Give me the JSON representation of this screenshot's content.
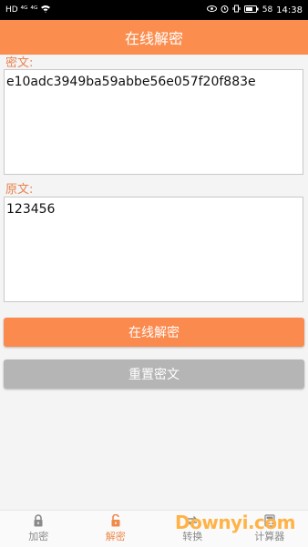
{
  "status_bar": {
    "left": "HD ⁴ᴳ ⁴ᴳ",
    "battery": "58",
    "time": "14:38"
  },
  "app": {
    "title": "在线解密"
  },
  "cipher": {
    "label": "密文:",
    "value": "e10adc3949ba59abbe56e057f20f883e"
  },
  "plain": {
    "label": "原文:",
    "value": "123456"
  },
  "buttons": {
    "decrypt": "在线解密",
    "reset": "重置密文"
  },
  "nav": {
    "items": [
      {
        "label": "加密",
        "icon": "lock-icon"
      },
      {
        "label": "解密",
        "icon": "unlock-icon"
      },
      {
        "label": "转换",
        "icon": "convert-icon"
      },
      {
        "label": "计算器",
        "icon": "calculator-icon"
      }
    ],
    "active": "解密"
  },
  "watermark": {
    "text": "Downyi.com"
  },
  "colors": {
    "accent": "#fb8e4e",
    "label": "#e88350",
    "reset": "#b5b5b5"
  }
}
